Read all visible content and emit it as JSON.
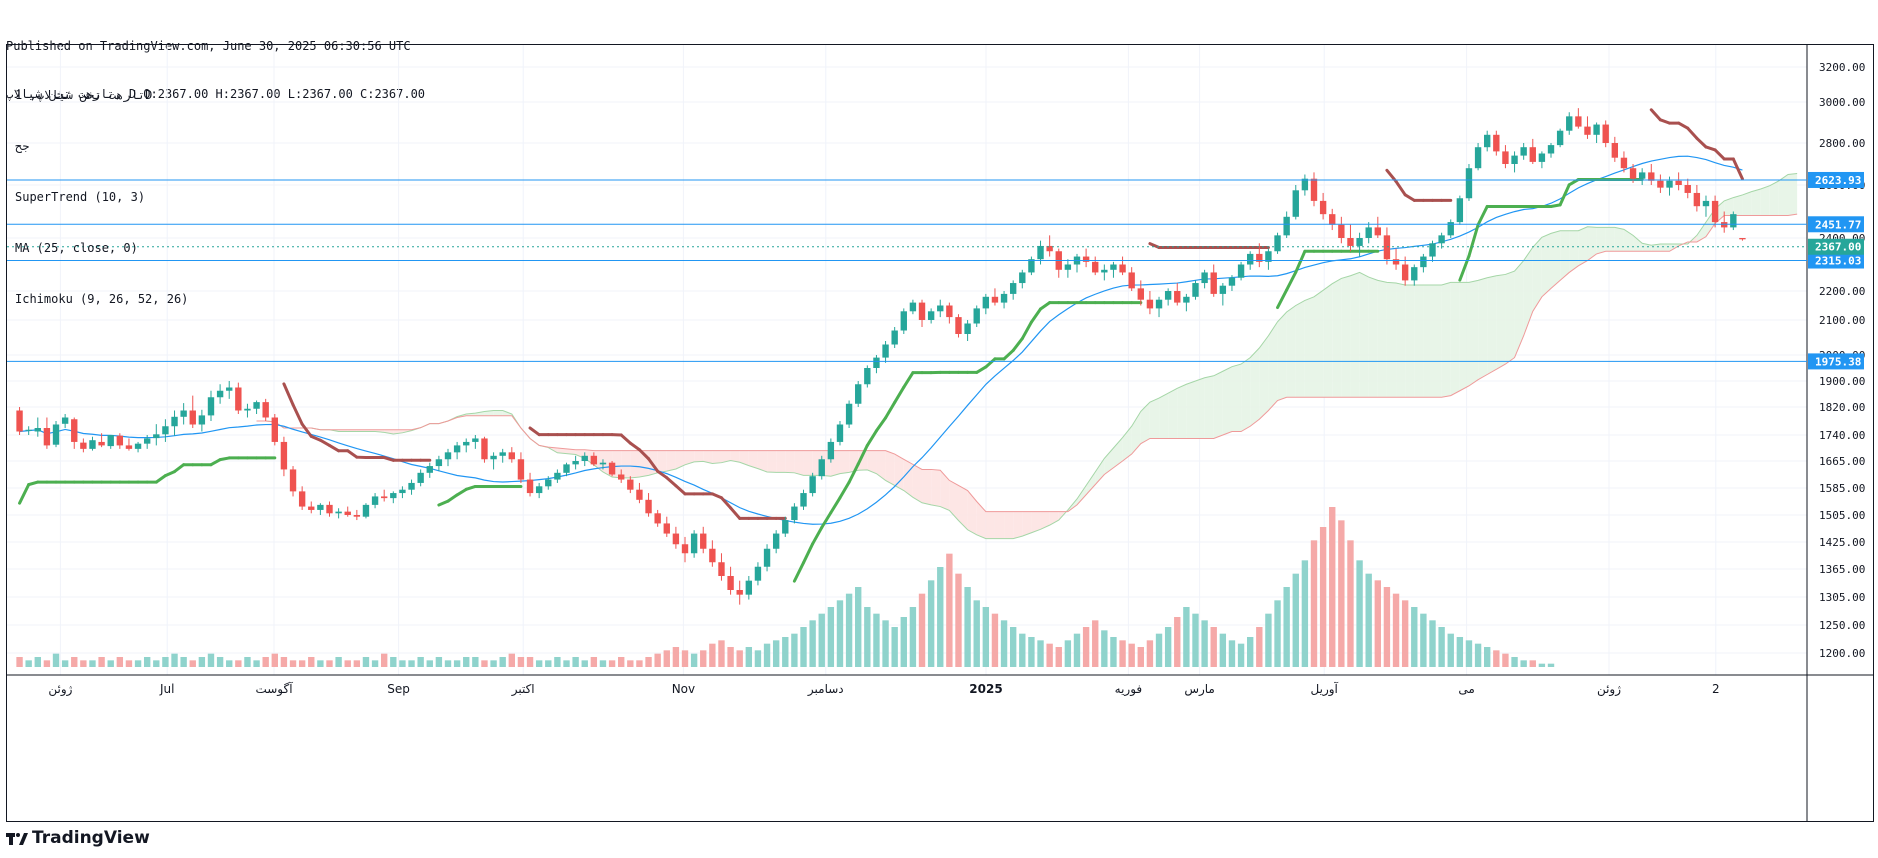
{
  "header": {
    "published": "Published on TradingView.com, June 30, 2025 06:30:56 UTC",
    "ohlc": "تارهت تخن شیالاپ, D O:2367.00 H:2367.00 L:2367.00 C:2367.00"
  },
  "legend": {
    "symbol": "تارهت تخن شیالاپ, 1D",
    "sub": "جح",
    "supertrend": "SuperTrend (10, 3)",
    "ma": "MA (25, close, 0)",
    "ichimoku": "Ichimoku (9, 26, 52, 26)"
  },
  "brand": {
    "name": "TradingView",
    "icon": "tradingview-logo-icon"
  },
  "colors": {
    "up": "#26a69a",
    "down": "#ef5350",
    "st_up": "#4caf50",
    "st_down": "#a9504f",
    "ma": "#2196f3",
    "hline": "#2196f3",
    "cloud_bull": "#e5f4e6",
    "cloud_bear": "#fde3e2",
    "span_a": "#a5d6a7",
    "span_b": "#ef9a9a",
    "vol_up": "#8fd3cc",
    "vol_down": "#f5a9a8",
    "badge_last": "#26a69a"
  },
  "chart_data": {
    "type": "candlestick",
    "y_ticks": [
      "3200.00",
      "3000.00",
      "2800.00",
      "2600.00",
      "2400.00",
      "2200.00",
      "2100.00",
      "2000.00",
      "1900.00",
      "1820.00",
      "1740.00",
      "1665.00",
      "1585.00",
      "1505.00",
      "1425.00",
      "1365.00",
      "1305.00",
      "1250.00",
      "1200.00"
    ],
    "x_ticks": [
      {
        "label": "ژوئن",
        "at": 0.03
      },
      {
        "label": "Jul",
        "at": 0.09
      },
      {
        "label": "آگوست",
        "at": 0.15
      },
      {
        "label": "Sep",
        "at": 0.22
      },
      {
        "label": "اکتبر",
        "at": 0.29
      },
      {
        "label": "Nov",
        "at": 0.38
      },
      {
        "label": "دسامبر",
        "at": 0.46
      },
      {
        "label": "2025",
        "at": 0.55
      },
      {
        "label": "فوریه",
        "at": 0.63
      },
      {
        "label": "مارس",
        "at": 0.67
      },
      {
        "label": "آوریل",
        "at": 0.74
      },
      {
        "label": "می",
        "at": 0.82
      },
      {
        "label": "ژوئن",
        "at": 0.9
      },
      {
        "label": "2",
        "at": 0.96
      }
    ],
    "price_lines": [
      {
        "label": "2623.93",
        "value": 2623.93,
        "style": "solid",
        "badge": "#2196f3"
      },
      {
        "label": "2451.77",
        "value": 2451.77,
        "style": "solid",
        "badge": "#2196f3"
      },
      {
        "label": "2315.03",
        "value": 2315.03,
        "style": "solid",
        "badge": "#2196f3"
      },
      {
        "label": "1975.38",
        "value": 1975.38,
        "style": "solid",
        "badge": "#2196f3"
      },
      {
        "label": "2367.00",
        "value": 2367.0,
        "style": "dotted",
        "badge": "#26a69a"
      }
    ],
    "candles_ohlc": [
      [
        1810,
        1820,
        1740,
        1750
      ],
      [
        1752,
        1765,
        1740,
        1755
      ],
      [
        1750,
        1790,
        1735,
        1760
      ],
      [
        1760,
        1790,
        1700,
        1710
      ],
      [
        1712,
        1780,
        1705,
        1770
      ],
      [
        1772,
        1800,
        1760,
        1790
      ],
      [
        1785,
        1790,
        1700,
        1720
      ],
      [
        1718,
        1730,
        1690,
        1700
      ],
      [
        1700,
        1735,
        1695,
        1725
      ],
      [
        1720,
        1745,
        1705,
        1710
      ],
      [
        1708,
        1740,
        1700,
        1740
      ],
      [
        1738,
        1745,
        1700,
        1710
      ],
      [
        1710,
        1730,
        1695,
        1700
      ],
      [
        1700,
        1720,
        1690,
        1715
      ],
      [
        1715,
        1740,
        1700,
        1730
      ],
      [
        1731,
        1771,
        1710,
        1742
      ],
      [
        1742,
        1785,
        1720,
        1765
      ],
      [
        1765,
        1810,
        1738,
        1792
      ],
      [
        1792,
        1832,
        1770,
        1810
      ],
      [
        1810,
        1855,
        1760,
        1770
      ],
      [
        1770,
        1812,
        1750,
        1796
      ],
      [
        1796,
        1870,
        1780,
        1850
      ],
      [
        1850,
        1890,
        1830,
        1870
      ],
      [
        1870,
        1900,
        1845,
        1880
      ],
      [
        1880,
        1895,
        1800,
        1810
      ],
      [
        1810,
        1830,
        1790,
        1815
      ],
      [
        1815,
        1840,
        1800,
        1835
      ],
      [
        1835,
        1845,
        1780,
        1790
      ],
      [
        1790,
        1800,
        1710,
        1720
      ],
      [
        1720,
        1735,
        1620,
        1640
      ],
      [
        1640,
        1650,
        1560,
        1575
      ],
      [
        1575,
        1590,
        1520,
        1530
      ],
      [
        1530,
        1545,
        1510,
        1520
      ],
      [
        1520,
        1540,
        1505,
        1535
      ],
      [
        1535,
        1545,
        1500,
        1510
      ],
      [
        1510,
        1525,
        1495,
        1515
      ],
      [
        1515,
        1530,
        1500,
        1505
      ],
      [
        1505,
        1520,
        1490,
        1500
      ],
      [
        1500,
        1540,
        1495,
        1535
      ],
      [
        1535,
        1570,
        1525,
        1560
      ],
      [
        1560,
        1580,
        1545,
        1555
      ],
      [
        1555,
        1575,
        1540,
        1570
      ],
      [
        1570,
        1590,
        1555,
        1580
      ],
      [
        1580,
        1610,
        1565,
        1600
      ],
      [
        1600,
        1640,
        1590,
        1630
      ],
      [
        1630,
        1660,
        1615,
        1650
      ],
      [
        1650,
        1680,
        1635,
        1670
      ],
      [
        1670,
        1700,
        1650,
        1690
      ],
      [
        1690,
        1720,
        1670,
        1710
      ],
      [
        1710,
        1730,
        1690,
        1720
      ],
      [
        1720,
        1740,
        1700,
        1730
      ],
      [
        1730,
        1735,
        1660,
        1670
      ],
      [
        1670,
        1690,
        1640,
        1680
      ],
      [
        1680,
        1700,
        1660,
        1690
      ],
      [
        1690,
        1705,
        1660,
        1670
      ],
      [
        1670,
        1690,
        1600,
        1610
      ],
      [
        1610,
        1630,
        1560,
        1570
      ],
      [
        1570,
        1600,
        1555,
        1590
      ],
      [
        1590,
        1620,
        1580,
        1610
      ],
      [
        1610,
        1640,
        1600,
        1630
      ],
      [
        1630,
        1660,
        1620,
        1655
      ],
      [
        1655,
        1680,
        1640,
        1665
      ],
      [
        1665,
        1690,
        1650,
        1680
      ],
      [
        1680,
        1690,
        1650,
        1655
      ],
      [
        1655,
        1670,
        1640,
        1660
      ],
      [
        1660,
        1665,
        1620,
        1625
      ],
      [
        1625,
        1640,
        1600,
        1610
      ],
      [
        1610,
        1620,
        1570,
        1580
      ],
      [
        1580,
        1600,
        1540,
        1550
      ],
      [
        1550,
        1570,
        1500,
        1510
      ],
      [
        1510,
        1520,
        1470,
        1480
      ],
      [
        1480,
        1500,
        1440,
        1450
      ],
      [
        1450,
        1470,
        1410,
        1420
      ],
      [
        1420,
        1440,
        1380,
        1400
      ],
      [
        1400,
        1460,
        1390,
        1450
      ],
      [
        1450,
        1470,
        1400,
        1410
      ],
      [
        1410,
        1430,
        1370,
        1380
      ],
      [
        1380,
        1400,
        1340,
        1350
      ],
      [
        1350,
        1370,
        1310,
        1320
      ],
      [
        1320,
        1340,
        1290,
        1310
      ],
      [
        1310,
        1350,
        1300,
        1340
      ],
      [
        1340,
        1380,
        1330,
        1370
      ],
      [
        1370,
        1420,
        1360,
        1410
      ],
      [
        1410,
        1460,
        1400,
        1450
      ],
      [
        1450,
        1500,
        1440,
        1490
      ],
      [
        1490,
        1540,
        1480,
        1530
      ],
      [
        1530,
        1580,
        1520,
        1570
      ],
      [
        1570,
        1630,
        1560,
        1620
      ],
      [
        1620,
        1680,
        1610,
        1670
      ],
      [
        1670,
        1730,
        1660,
        1720
      ],
      [
        1720,
        1780,
        1710,
        1770
      ],
      [
        1770,
        1840,
        1760,
        1830
      ],
      [
        1830,
        1900,
        1820,
        1890
      ],
      [
        1890,
        1960,
        1880,
        1950
      ],
      [
        1950,
        2000,
        1930,
        1990
      ],
      [
        1990,
        2040,
        1970,
        2030
      ],
      [
        2030,
        2080,
        2020,
        2070
      ],
      [
        2070,
        2140,
        2060,
        2130
      ],
      [
        2130,
        2170,
        2120,
        2160
      ],
      [
        2160,
        2170,
        2080,
        2100
      ],
      [
        2100,
        2140,
        2090,
        2130
      ],
      [
        2130,
        2170,
        2110,
        2150
      ],
      [
        2150,
        2160,
        2090,
        2110
      ],
      [
        2110,
        2120,
        2050,
        2060
      ],
      [
        2060,
        2100,
        2040,
        2090
      ],
      [
        2090,
        2150,
        2080,
        2140
      ],
      [
        2140,
        2190,
        2120,
        2180
      ],
      [
        2180,
        2210,
        2150,
        2160
      ],
      [
        2160,
        2200,
        2140,
        2190
      ],
      [
        2190,
        2240,
        2170,
        2230
      ],
      [
        2230,
        2280,
        2210,
        2270
      ],
      [
        2270,
        2330,
        2260,
        2320
      ],
      [
        2320,
        2390,
        2300,
        2370
      ],
      [
        2370,
        2410,
        2330,
        2350
      ],
      [
        2350,
        2360,
        2250,
        2280
      ],
      [
        2280,
        2320,
        2250,
        2300
      ],
      [
        2300,
        2340,
        2270,
        2330
      ],
      [
        2330,
        2360,
        2290,
        2310
      ],
      [
        2310,
        2330,
        2260,
        2270
      ],
      [
        2270,
        2300,
        2240,
        2280
      ],
      [
        2280,
        2310,
        2250,
        2300
      ],
      [
        2300,
        2330,
        2260,
        2270
      ],
      [
        2270,
        2290,
        2200,
        2210
      ],
      [
        2210,
        2240,
        2150,
        2170
      ],
      [
        2170,
        2200,
        2120,
        2140
      ],
      [
        2140,
        2180,
        2110,
        2170
      ],
      [
        2170,
        2210,
        2150,
        2200
      ],
      [
        2200,
        2230,
        2150,
        2160
      ],
      [
        2160,
        2190,
        2130,
        2180
      ],
      [
        2180,
        2240,
        2170,
        2230
      ],
      [
        2230,
        2280,
        2210,
        2270
      ],
      [
        2270,
        2300,
        2180,
        2190
      ],
      [
        2190,
        2230,
        2150,
        2220
      ],
      [
        2220,
        2260,
        2200,
        2250
      ],
      [
        2250,
        2310,
        2240,
        2300
      ],
      [
        2300,
        2350,
        2280,
        2340
      ],
      [
        2340,
        2380,
        2290,
        2310
      ],
      [
        2310,
        2360,
        2280,
        2350
      ],
      [
        2350,
        2420,
        2340,
        2410
      ],
      [
        2410,
        2500,
        2400,
        2480
      ],
      [
        2480,
        2600,
        2470,
        2580
      ],
      [
        2580,
        2650,
        2560,
        2630
      ],
      [
        2630,
        2660,
        2520,
        2540
      ],
      [
        2540,
        2570,
        2470,
        2490
      ],
      [
        2490,
        2510,
        2430,
        2450
      ],
      [
        2450,
        2480,
        2380,
        2400
      ],
      [
        2400,
        2450,
        2350,
        2370
      ],
      [
        2370,
        2420,
        2330,
        2400
      ],
      [
        2400,
        2460,
        2380,
        2440
      ],
      [
        2440,
        2480,
        2400,
        2410
      ],
      [
        2410,
        2440,
        2300,
        2320
      ],
      [
        2320,
        2360,
        2280,
        2300
      ],
      [
        2300,
        2330,
        2220,
        2240
      ],
      [
        2240,
        2300,
        2220,
        2290
      ],
      [
        2290,
        2340,
        2270,
        2330
      ],
      [
        2330,
        2390,
        2310,
        2380
      ],
      [
        2380,
        2420,
        2360,
        2410
      ],
      [
        2410,
        2470,
        2400,
        2460
      ],
      [
        2460,
        2560,
        2450,
        2550
      ],
      [
        2550,
        2700,
        2540,
        2680
      ],
      [
        2680,
        2800,
        2670,
        2780
      ],
      [
        2780,
        2860,
        2760,
        2840
      ],
      [
        2840,
        2860,
        2740,
        2760
      ],
      [
        2760,
        2790,
        2680,
        2700
      ],
      [
        2700,
        2760,
        2660,
        2740
      ],
      [
        2740,
        2800,
        2720,
        2780
      ],
      [
        2780,
        2820,
        2700,
        2710
      ],
      [
        2710,
        2760,
        2680,
        2750
      ],
      [
        2750,
        2800,
        2730,
        2790
      ],
      [
        2790,
        2870,
        2780,
        2860
      ],
      [
        2860,
        2950,
        2840,
        2930
      ],
      [
        2930,
        2970,
        2870,
        2880
      ],
      [
        2880,
        2930,
        2820,
        2840
      ],
      [
        2840,
        2900,
        2800,
        2890
      ],
      [
        2890,
        2910,
        2780,
        2800
      ],
      [
        2800,
        2830,
        2710,
        2730
      ],
      [
        2730,
        2760,
        2660,
        2680
      ],
      [
        2680,
        2700,
        2610,
        2630
      ],
      [
        2630,
        2680,
        2600,
        2660
      ],
      [
        2660,
        2700,
        2600,
        2620
      ],
      [
        2620,
        2650,
        2570,
        2590
      ],
      [
        2590,
        2640,
        2560,
        2620
      ],
      [
        2620,
        2660,
        2580,
        2600
      ],
      [
        2600,
        2630,
        2550,
        2570
      ],
      [
        2570,
        2600,
        2500,
        2520
      ],
      [
        2520,
        2560,
        2480,
        2540
      ],
      [
        2540,
        2560,
        2440,
        2460
      ],
      [
        2460,
        2500,
        2420,
        2440
      ],
      [
        2440,
        2500,
        2430,
        2490
      ],
      [
        2400,
        2400,
        2390,
        2395
      ]
    ],
    "volume": [
      3,
      2,
      3,
      2,
      4,
      2,
      3,
      2,
      2,
      3,
      2,
      3,
      2,
      2,
      3,
      2,
      3,
      4,
      3,
      2,
      3,
      4,
      3,
      2,
      2,
      3,
      2,
      3,
      4,
      3,
      2,
      2,
      3,
      2,
      2,
      3,
      2,
      2,
      3,
      2,
      4,
      3,
      2,
      2,
      3,
      2,
      3,
      2,
      2,
      3,
      3,
      2,
      2,
      3,
      4,
      3,
      3,
      2,
      2,
      3,
      2,
      3,
      2,
      3,
      2,
      2,
      3,
      2,
      2,
      3,
      4,
      5,
      6,
      5,
      4,
      5,
      7,
      8,
      6,
      5,
      6,
      5,
      7,
      8,
      9,
      10,
      12,
      14,
      16,
      18,
      20,
      22,
      24,
      18,
      16,
      14,
      12,
      15,
      18,
      22,
      26,
      30,
      34,
      28,
      24,
      20,
      18,
      16,
      14,
      12,
      10,
      9,
      8,
      7,
      6,
      8,
      10,
      12,
      14,
      11,
      9,
      8,
      7,
      6,
      8,
      10,
      12,
      15,
      18,
      16,
      14,
      12,
      10,
      8,
      7,
      9,
      12,
      16,
      20,
      24,
      28,
      32,
      38,
      42,
      48,
      44,
      38,
      32,
      28,
      26,
      24,
      22,
      20,
      18,
      16,
      14,
      12,
      10,
      9,
      8,
      7,
      6,
      5,
      4,
      3,
      2,
      2,
      1,
      1
    ],
    "supertrend": {
      "start": 2390,
      "end": 2620
    }
  }
}
